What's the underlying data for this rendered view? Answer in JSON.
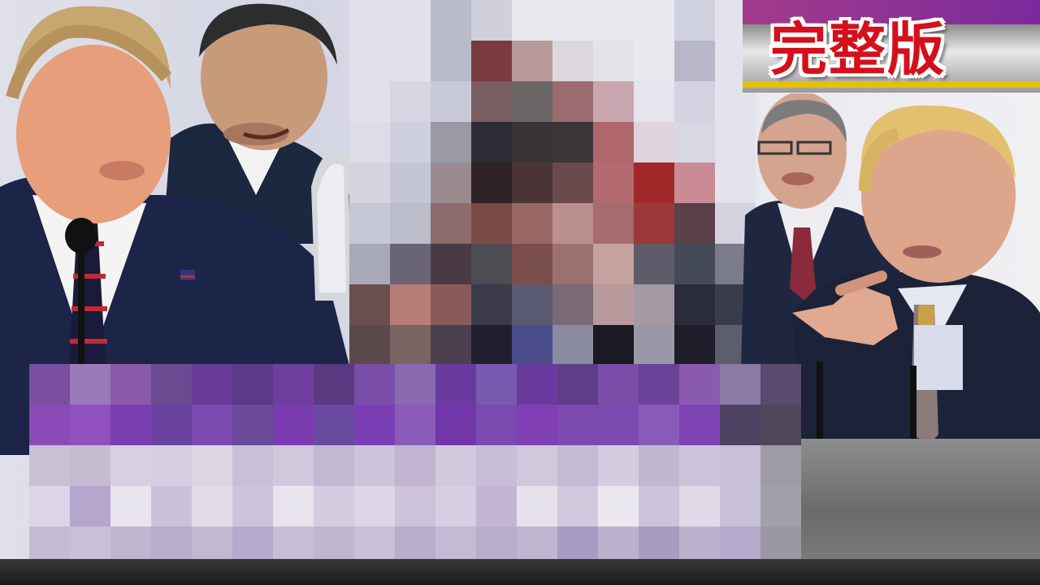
{
  "banner": {
    "text": "完整版",
    "text_color": "#d4101c",
    "stripe_color": "#e5c100"
  },
  "image": {
    "people": [
      {
        "id": "left-speaker"
      },
      {
        "id": "second-speaker"
      },
      {
        "id": "top-right-speaker"
      },
      {
        "id": "right-speaker-pointing"
      }
    ],
    "pixelated_regions": [
      {
        "id": "center-pixelated-person"
      },
      {
        "id": "lower-pixelated-caption"
      }
    ]
  }
}
